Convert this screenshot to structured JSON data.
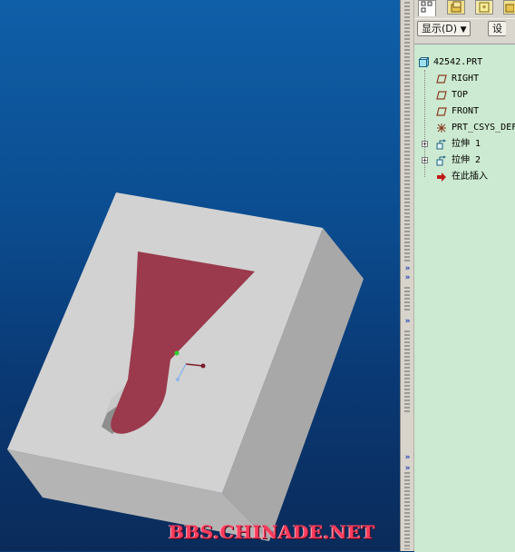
{
  "viewport": {
    "watermark": "BBS.CHINADE.NET",
    "colors": {
      "block_face": "#c5c5c5",
      "block_top": "#d6d6d6",
      "block_side": "#a9a9a9",
      "cut_face": "#9a3a4c",
      "background_top": "#0f5fa8",
      "background_bottom": "#0a2b5a"
    }
  },
  "toolbar": {
    "tabs": [
      {
        "icon": "model-tree-icon"
      },
      {
        "icon": "folder-browser-icon"
      },
      {
        "icon": "favorites-icon"
      },
      {
        "icon": "folder-icon"
      }
    ]
  },
  "controls": {
    "show_button": "显示(D)",
    "show_caret": "▼",
    "settings_button": "设"
  },
  "model_tree": {
    "root": {
      "label": "42542.PRT",
      "icon": "part-icon"
    },
    "items": [
      {
        "label": "RIGHT",
        "icon": "datum-plane-icon",
        "expandable": false
      },
      {
        "label": "TOP",
        "icon": "datum-plane-icon",
        "expandable": false
      },
      {
        "label": "FRONT",
        "icon": "datum-plane-icon",
        "expandable": false
      },
      {
        "label": "PRT_CSYS_DEF",
        "icon": "coordinate-system-icon",
        "expandable": false
      },
      {
        "label": "拉伸 1",
        "icon": "extrude-icon",
        "expandable": true
      },
      {
        "label": "拉伸 2",
        "icon": "extrude-icon",
        "expandable": true
      },
      {
        "label": "在此插入",
        "icon": "insert-here-arrow-icon",
        "expandable": false
      }
    ],
    "expander_glyph": "+"
  },
  "splitter": {
    "collapse_glyph": "»"
  }
}
